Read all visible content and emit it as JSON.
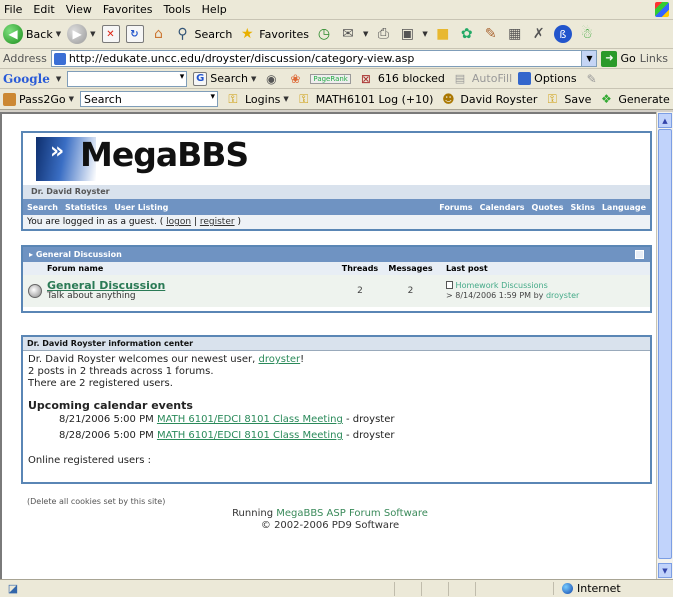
{
  "browser": {
    "menu": [
      "File",
      "Edit",
      "View",
      "Favorites",
      "Tools",
      "Help"
    ],
    "toolbar": {
      "back_label": "Back",
      "search_label": "Search",
      "favorites_label": "Favorites"
    },
    "address": {
      "label": "Address",
      "url": "http://edukate.uncc.edu/droyster/discussion/category-view.asp",
      "go_label": "Go",
      "links_label": "Links"
    },
    "google_bar": {
      "logo": "Google",
      "search_label": "Search",
      "pagerank_label": "PageRank",
      "blocked_label": "616 blocked",
      "autofill_label": "AutoFill",
      "options_label": "Options"
    },
    "links_bar": {
      "pass2go_label": "Pass2Go",
      "search_placeholder": "Search",
      "logins_label": "Logins",
      "math_log_label": "MATH6101 Log (+10)",
      "user_label": "David Royster",
      "save_label": "Save",
      "generate_label": "Generate"
    },
    "status": {
      "zone_label": "Internet"
    }
  },
  "forum": {
    "logo_text": "MegaBBS",
    "owner_name": "Dr. David Royster",
    "nav_left": [
      "Search",
      "Statistics",
      "User Listing"
    ],
    "nav_right": [
      "Forums",
      "Calendars",
      "Quotes",
      "Skins",
      "Language"
    ],
    "guest": {
      "prefix": "You are logged in as a guest. (",
      "logon": "logon",
      "separator": "|",
      "register": "register",
      "suffix": ")"
    },
    "category": {
      "title": "General Discussion",
      "columns": [
        "Forum name",
        "Threads",
        "Messages",
        "Last post"
      ],
      "rows": [
        {
          "name": "General Discussion",
          "description": "Talk about anything",
          "threads": "2",
          "messages": "2",
          "last_post_title": "Homework Discussions",
          "last_post_meta_prefix": "> 8/14/2006 1:59 PM by",
          "last_post_author": "droyster"
        }
      ]
    },
    "info_center": {
      "title": "Dr. David Royster information center",
      "welcome_prefix": "Dr. David Royster welcomes our newest user,",
      "newest_user": "droyster",
      "welcome_suffix": "!",
      "posts_line": "2 posts in 2 threads across 1 forums.",
      "users_line": "There are 2 registered users.",
      "calendar_title": "Upcoming calendar events",
      "events": [
        {
          "when": "8/21/2006 5:00 PM",
          "title": "MATH 6101/EDCI 8101 Class Meeting",
          "by": "- droyster"
        },
        {
          "when": "8/28/2006 5:00 PM",
          "title": "MATH 6101/EDCI 8101 Class Meeting",
          "by": "- droyster"
        }
      ],
      "online_label": "Online registered users :"
    },
    "footer": {
      "delete_cookies": "(Delete all cookies set by this site)",
      "running_prefix": "Running",
      "software_link": "MegaBBS ASP Forum Software",
      "copyright": "© 2002-2006 PD9 Software"
    }
  }
}
